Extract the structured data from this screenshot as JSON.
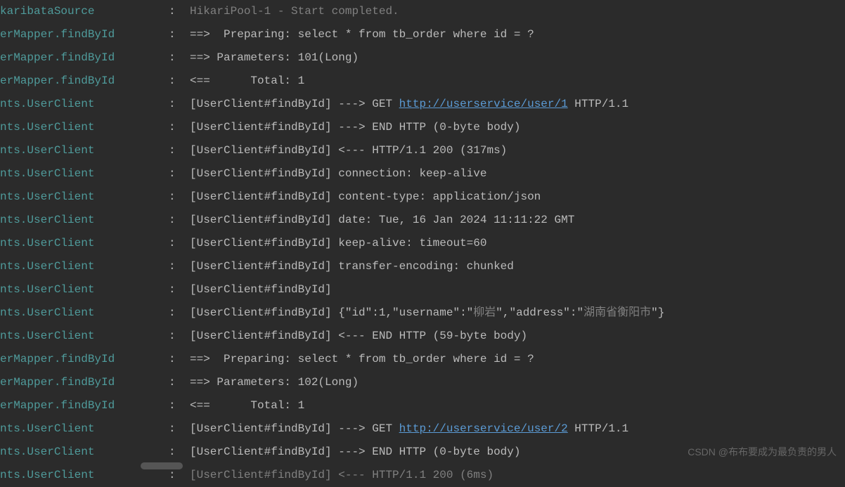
{
  "lines": [
    {
      "logger": "karibataSource",
      "sep": ":",
      "msg": "HikariPool-1 - Start completed.",
      "gray": true
    },
    {
      "logger": "erMapper.findById",
      "sep": ":",
      "msg": "==>  Preparing: select * from tb_order where id = ?"
    },
    {
      "logger": "erMapper.findById",
      "sep": ":",
      "msg": "==> Parameters: 101(Long)"
    },
    {
      "logger": "erMapper.findById",
      "sep": ":",
      "msg": "<==      Total: 1"
    },
    {
      "logger": "nts.UserClient",
      "sep": ":",
      "msg_pre": "[UserClient#findById] ---> GET ",
      "link": "http://userservice/user/1",
      "msg_post": " HTTP/1.1"
    },
    {
      "logger": "nts.UserClient",
      "sep": ":",
      "msg": "[UserClient#findById] ---> END HTTP (0-byte body)"
    },
    {
      "logger": "nts.UserClient",
      "sep": ":",
      "msg": "[UserClient#findById] <--- HTTP/1.1 200 (317ms)"
    },
    {
      "logger": "nts.UserClient",
      "sep": ":",
      "msg": "[UserClient#findById] connection: keep-alive"
    },
    {
      "logger": "nts.UserClient",
      "sep": ":",
      "msg": "[UserClient#findById] content-type: application/json"
    },
    {
      "logger": "nts.UserClient",
      "sep": ":",
      "msg": "[UserClient#findById] date: Tue, 16 Jan 2024 11:11:22 GMT"
    },
    {
      "logger": "nts.UserClient",
      "sep": ":",
      "msg": "[UserClient#findById] keep-alive: timeout=60"
    },
    {
      "logger": "nts.UserClient",
      "sep": ":",
      "msg": "[UserClient#findById] transfer-encoding: chunked"
    },
    {
      "logger": "nts.UserClient",
      "sep": ":",
      "msg": "[UserClient#findById] "
    },
    {
      "logger": "nts.UserClient",
      "sep": ":",
      "msg_pre": "[UserClient#findById] {\"id\":1,\"username\":\"",
      "gray_mid1": "柳岩",
      "msg_mid": "\",\"address\":\"",
      "gray_mid2": "湖南省衡阳市",
      "msg_post": "\"}"
    },
    {
      "logger": "nts.UserClient",
      "sep": ":",
      "msg": "[UserClient#findById] <--- END HTTP (59-byte body)"
    },
    {
      "logger": "erMapper.findById",
      "sep": ":",
      "msg": "==>  Preparing: select * from tb_order where id = ?"
    },
    {
      "logger": "erMapper.findById",
      "sep": ":",
      "msg": "==> Parameters: 102(Long)"
    },
    {
      "logger": "erMapper.findById",
      "sep": ":",
      "msg": "<==      Total: 1"
    },
    {
      "logger": "nts.UserClient",
      "sep": ":",
      "msg_pre": "[UserClient#findById] ---> GET ",
      "link": "http://userservice/user/2",
      "msg_post": " HTTP/1.1"
    },
    {
      "logger": "nts.UserClient",
      "sep": ":",
      "msg": "[UserClient#findById] ---> END HTTP (0-byte body)"
    },
    {
      "logger": "nts.UserClient",
      "sep": ":",
      "msg": "[UserClient#findById] <--- HTTP/1.1 200 (6ms)",
      "gray": true
    }
  ],
  "watermark": "CSDN @布布要成为最负责的男人"
}
